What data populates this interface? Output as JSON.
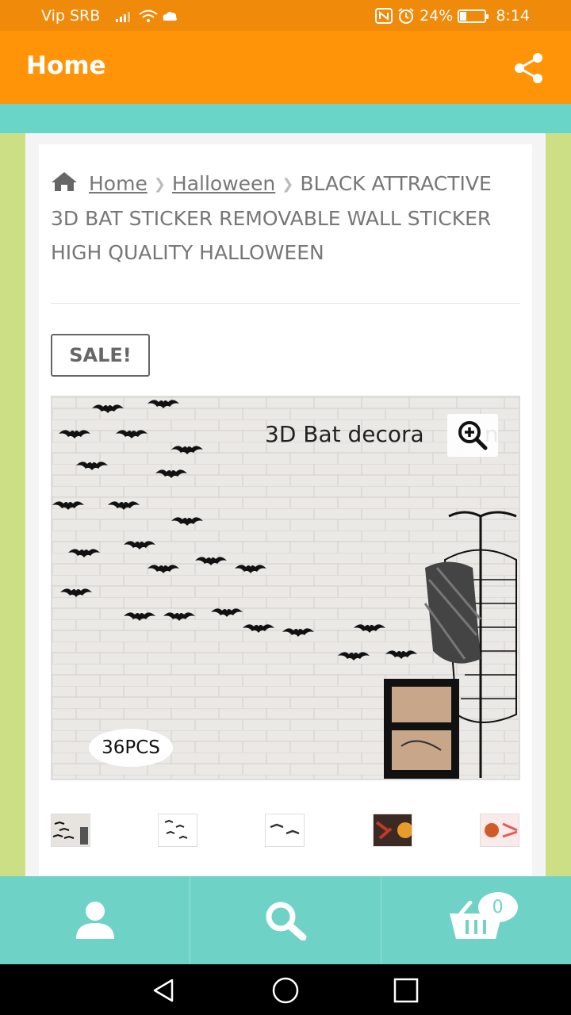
{
  "status_bar": {
    "carrier": "Vip SRB",
    "battery": "24%",
    "battery_level": 0.24,
    "time": "8:14"
  },
  "app_bar": {
    "title": "Home",
    "share_icon": "share-icon"
  },
  "breadcrumb": {
    "home_icon": "home-icon",
    "home_label": "Home",
    "category_label": "Halloween",
    "current": "BLACK ATTRACTIVE 3D BAT STICKER REMOVABLE WALL STICKER HIGH QUALITY HALLOWEEN"
  },
  "product": {
    "sale_badge": "SALE!",
    "image_caption": "3D Bat decora",
    "image_caption_tail": "n",
    "quantity_label": "36PCS",
    "zoom_icon": "zoom-in-icon",
    "thumbnail_count": 5
  },
  "bottom_nav": {
    "items": [
      {
        "icon": "user-icon"
      },
      {
        "icon": "search-icon"
      },
      {
        "icon": "cart-icon"
      }
    ],
    "cart_count": "0"
  },
  "colors": {
    "status_bar": "#f08a0a",
    "app_bar": "#ff9408",
    "teal": "#68d5c8",
    "lime": "#cddf85"
  }
}
